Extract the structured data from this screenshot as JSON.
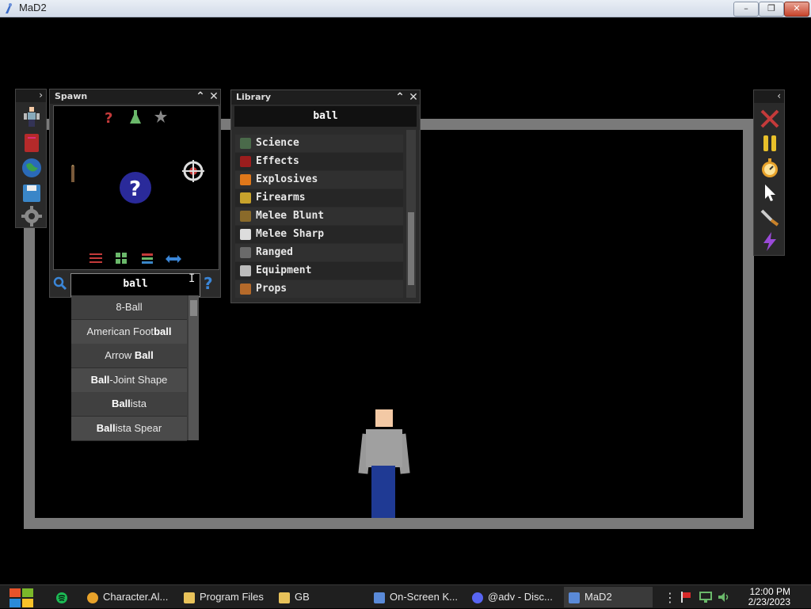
{
  "window": {
    "title": "MaD2"
  },
  "spawn": {
    "title": "Spawn",
    "search_value": "ball",
    "dropdown": [
      {
        "pre": "",
        "hl": "",
        "post": "8-Ball"
      },
      {
        "pre": "American Foot",
        "hl": "ball",
        "post": ""
      },
      {
        "pre": "Arrow ",
        "hl": "Ball",
        "post": ""
      },
      {
        "pre": "",
        "hl": "Ball",
        "post": "-Joint Shape"
      },
      {
        "pre": "",
        "hl": "Ball",
        "post": "ista"
      },
      {
        "pre": "",
        "hl": "Ball",
        "post": "ista Spear"
      }
    ]
  },
  "library": {
    "title": "Library",
    "search_title": "ball",
    "items": [
      {
        "label": "Science",
        "color": "#4a6a4a"
      },
      {
        "label": "Effects",
        "color": "#9b1d1d"
      },
      {
        "label": "Explosives",
        "color": "#e0781a"
      },
      {
        "label": "Firearms",
        "color": "#c8a32c"
      },
      {
        "label": "Melee Blunt",
        "color": "#8a6a2a"
      },
      {
        "label": "Melee Sharp",
        "color": "#dddddd"
      },
      {
        "label": "Ranged",
        "color": "#6a6a6a"
      },
      {
        "label": "Equipment",
        "color": "#bbbbbb"
      },
      {
        "label": "Props",
        "color": "#b56a2a"
      }
    ]
  },
  "taskbar": {
    "items": [
      {
        "label": "Character.Al...",
        "icon": "chrome-icon"
      },
      {
        "label": "Program Files",
        "icon": "folder-icon"
      },
      {
        "label": "GB",
        "icon": "folder-icon"
      },
      {
        "label": "On-Screen K...",
        "icon": "keyboard-icon"
      },
      {
        "label": "@adv - Disc...",
        "icon": "discord-icon"
      },
      {
        "label": "MaD2",
        "icon": "mad2-icon"
      }
    ],
    "time": "12:00 PM",
    "date": "2/23/2023"
  }
}
